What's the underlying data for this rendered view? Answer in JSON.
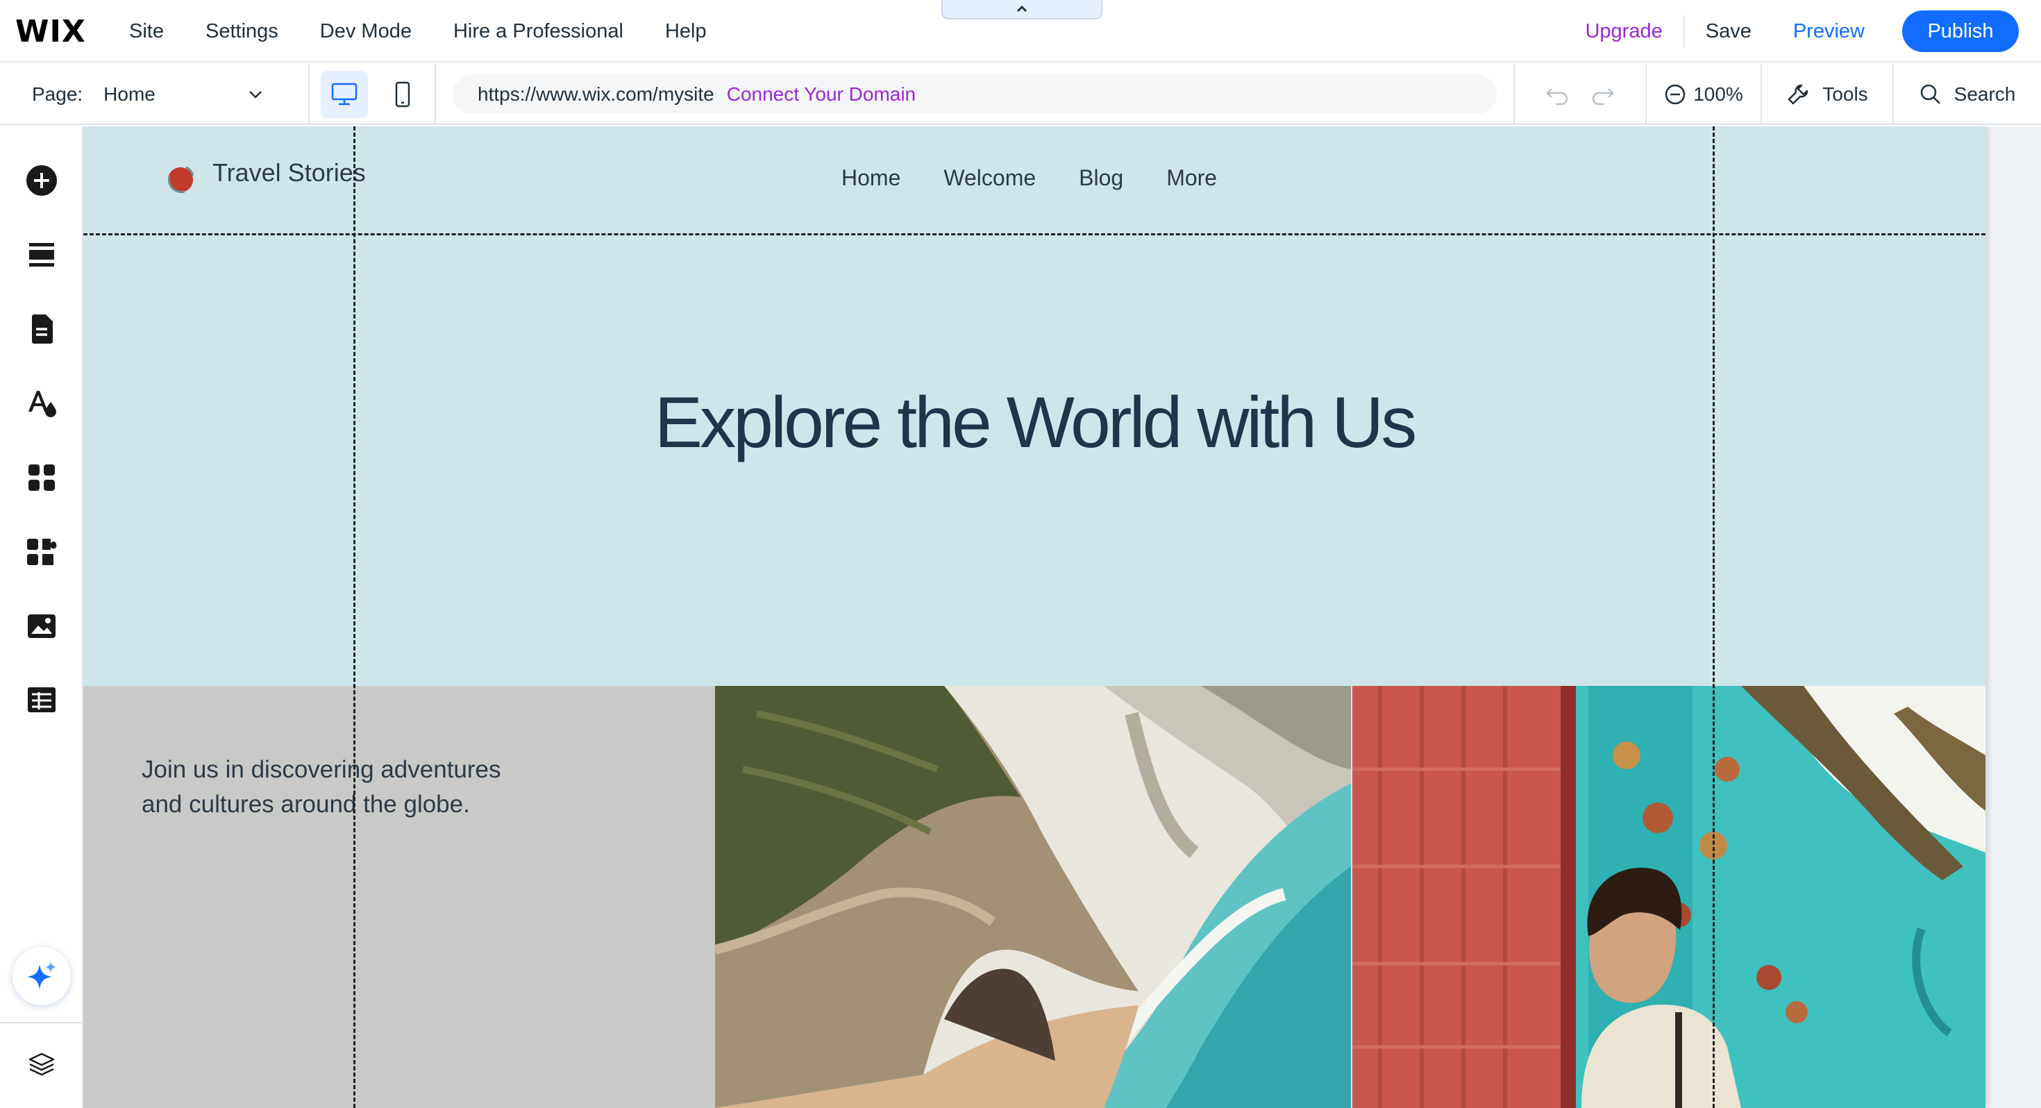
{
  "topbar": {
    "logo": "WIX",
    "menu": [
      "Site",
      "Settings",
      "Dev Mode",
      "Hire a Professional",
      "Help"
    ],
    "upgrade": "Upgrade",
    "save": "Save",
    "preview": "Preview",
    "publish": "Publish"
  },
  "toolbar": {
    "page_label": "Page:",
    "page_value": "Home",
    "url": "https://www.wix.com/mysite",
    "connect_domain": "Connect Your Domain",
    "zoom": "100%",
    "tools": "Tools",
    "search": "Search"
  },
  "rail": {
    "icons": [
      "add-elements-icon",
      "sections-icon",
      "pages-icon",
      "site-design-icon",
      "apps-icon",
      "business-apps-icon",
      "media-icon",
      "cms-icon",
      "ai-assistant-icon",
      "layers-icon"
    ]
  },
  "site": {
    "name": "Travel Stories",
    "nav": [
      "Home",
      "Welcome",
      "Blog",
      "More"
    ],
    "hero_title": "Explore the World with Us",
    "intro_text": "Join us in discovering adventures and cultures around the globe."
  },
  "colors": {
    "accent": "#116dff",
    "upgrade": "#9a27d5",
    "hero_bg": "#cee6ea",
    "band_bg": "#c9cac8",
    "logo_red": "#c0392b"
  }
}
